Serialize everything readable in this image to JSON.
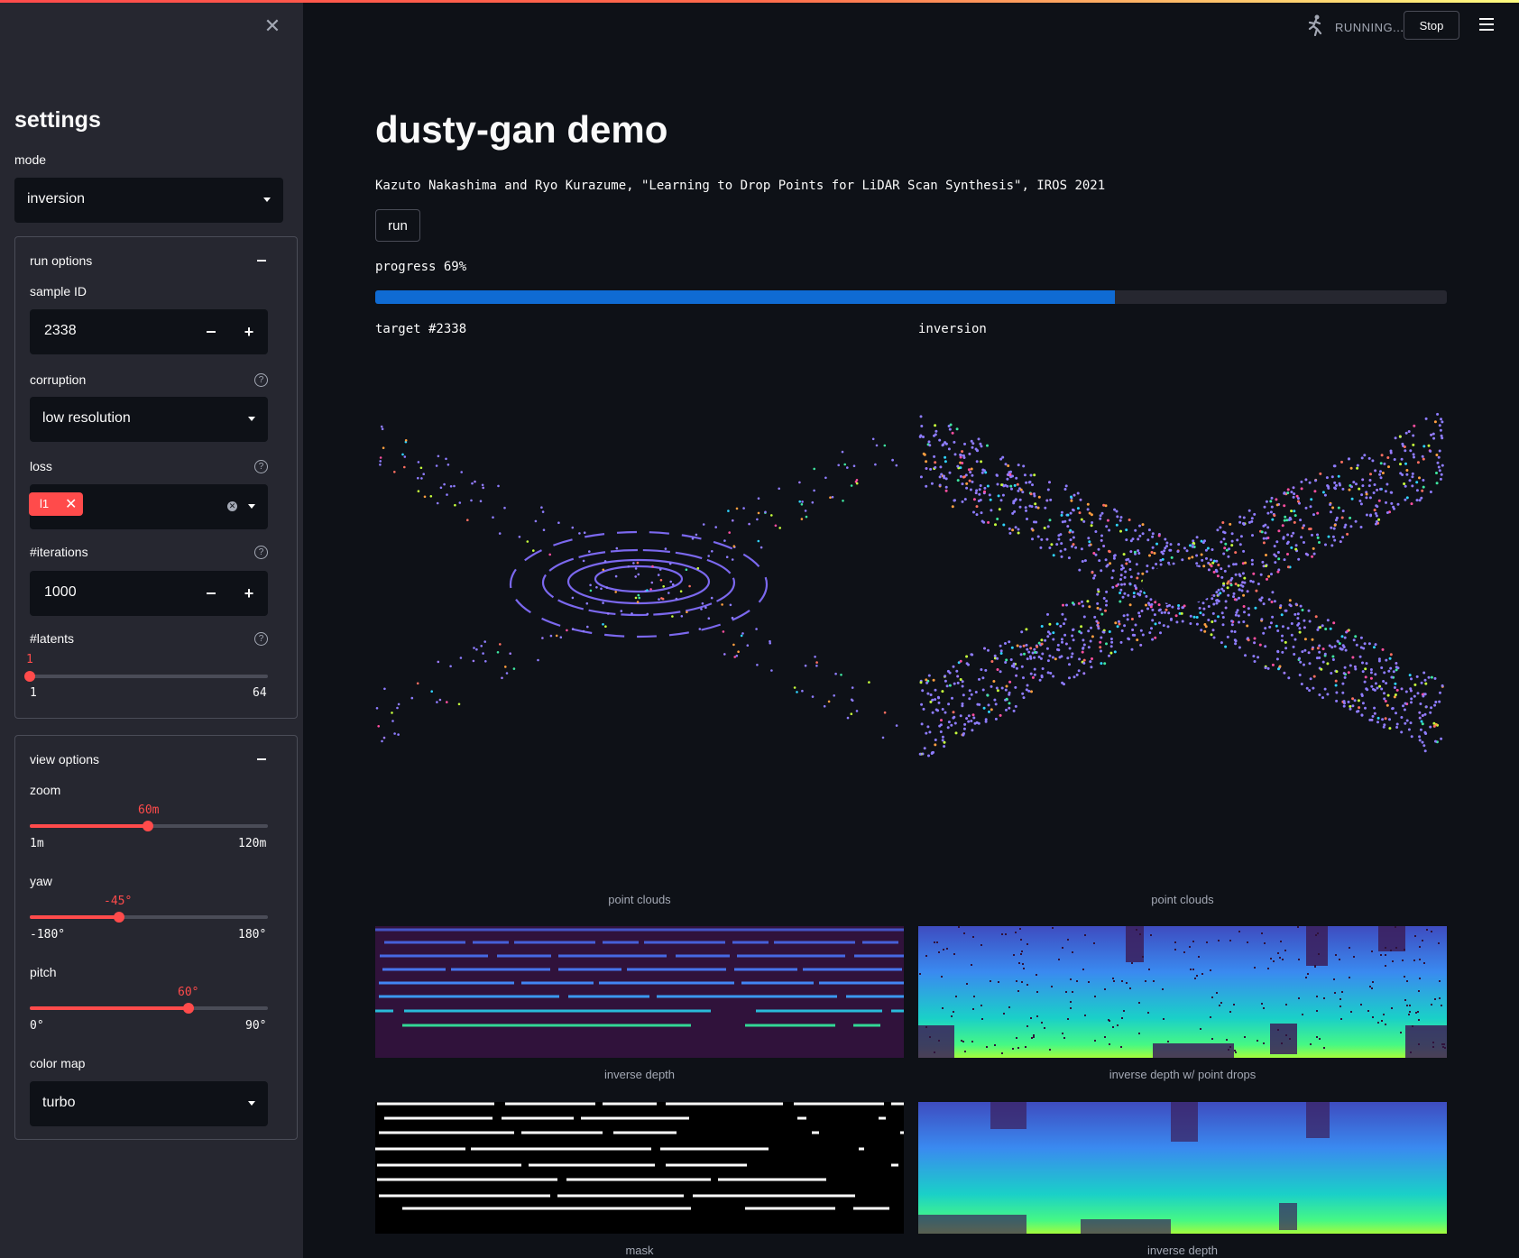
{
  "colors": {
    "accent": "#ff4b4b",
    "progress": "#0f6bd3",
    "bg": "#0e1117",
    "sidebar": "#262730"
  },
  "sidebar": {
    "close_icon": "close-icon",
    "title": "settings",
    "mode_label": "mode",
    "mode_value": "inversion",
    "run_options": {
      "header": "run options",
      "sample_id_label": "sample ID",
      "sample_id_value": "2338",
      "corruption_label": "corruption",
      "corruption_value": "low resolution",
      "loss_label": "loss",
      "loss_tag": "l1",
      "iterations_label": "#iterations",
      "iterations_value": "1000",
      "latents_label": "#latents",
      "latents_value": "1",
      "latents_min": "1",
      "latents_max": "64",
      "latents_fraction": 0
    },
    "view_options": {
      "header": "view options",
      "zoom_label": "zoom",
      "zoom_value": "60m",
      "zoom_min": "1m",
      "zoom_max": "120m",
      "zoom_fraction": 0.496,
      "yaw_label": "yaw",
      "yaw_value": "-45°",
      "yaw_min": "-180°",
      "yaw_max": "180°",
      "yaw_fraction": 0.375,
      "pitch_label": "pitch",
      "pitch_value": "60°",
      "pitch_min": "0°",
      "pitch_max": "90°",
      "pitch_fraction": 0.667,
      "colormap_label": "color map",
      "colormap_value": "turbo"
    }
  },
  "header": {
    "status": "RUNNING...",
    "stop_label": "Stop",
    "menu_icon": "hamburger-menu-icon",
    "running_icon": "running-man-icon"
  },
  "main": {
    "title": "dusty-gan demo",
    "citation": "Kazuto Nakashima and Ryo Kurazume, \"Learning to Drop Points for LiDAR Scan Synthesis\", IROS 2021",
    "run_label": "run",
    "progress_label": "progress 69%",
    "progress_fraction": 0.69,
    "left_col_title": "target #2338",
    "right_col_title": "inversion",
    "captions": {
      "left_pc": "point clouds",
      "right_pc": "point clouds",
      "left_depth": "inverse depth",
      "right_depth": "inverse depth w/ point drops",
      "left_mask": "mask",
      "right_depth2": "inverse depth"
    }
  }
}
